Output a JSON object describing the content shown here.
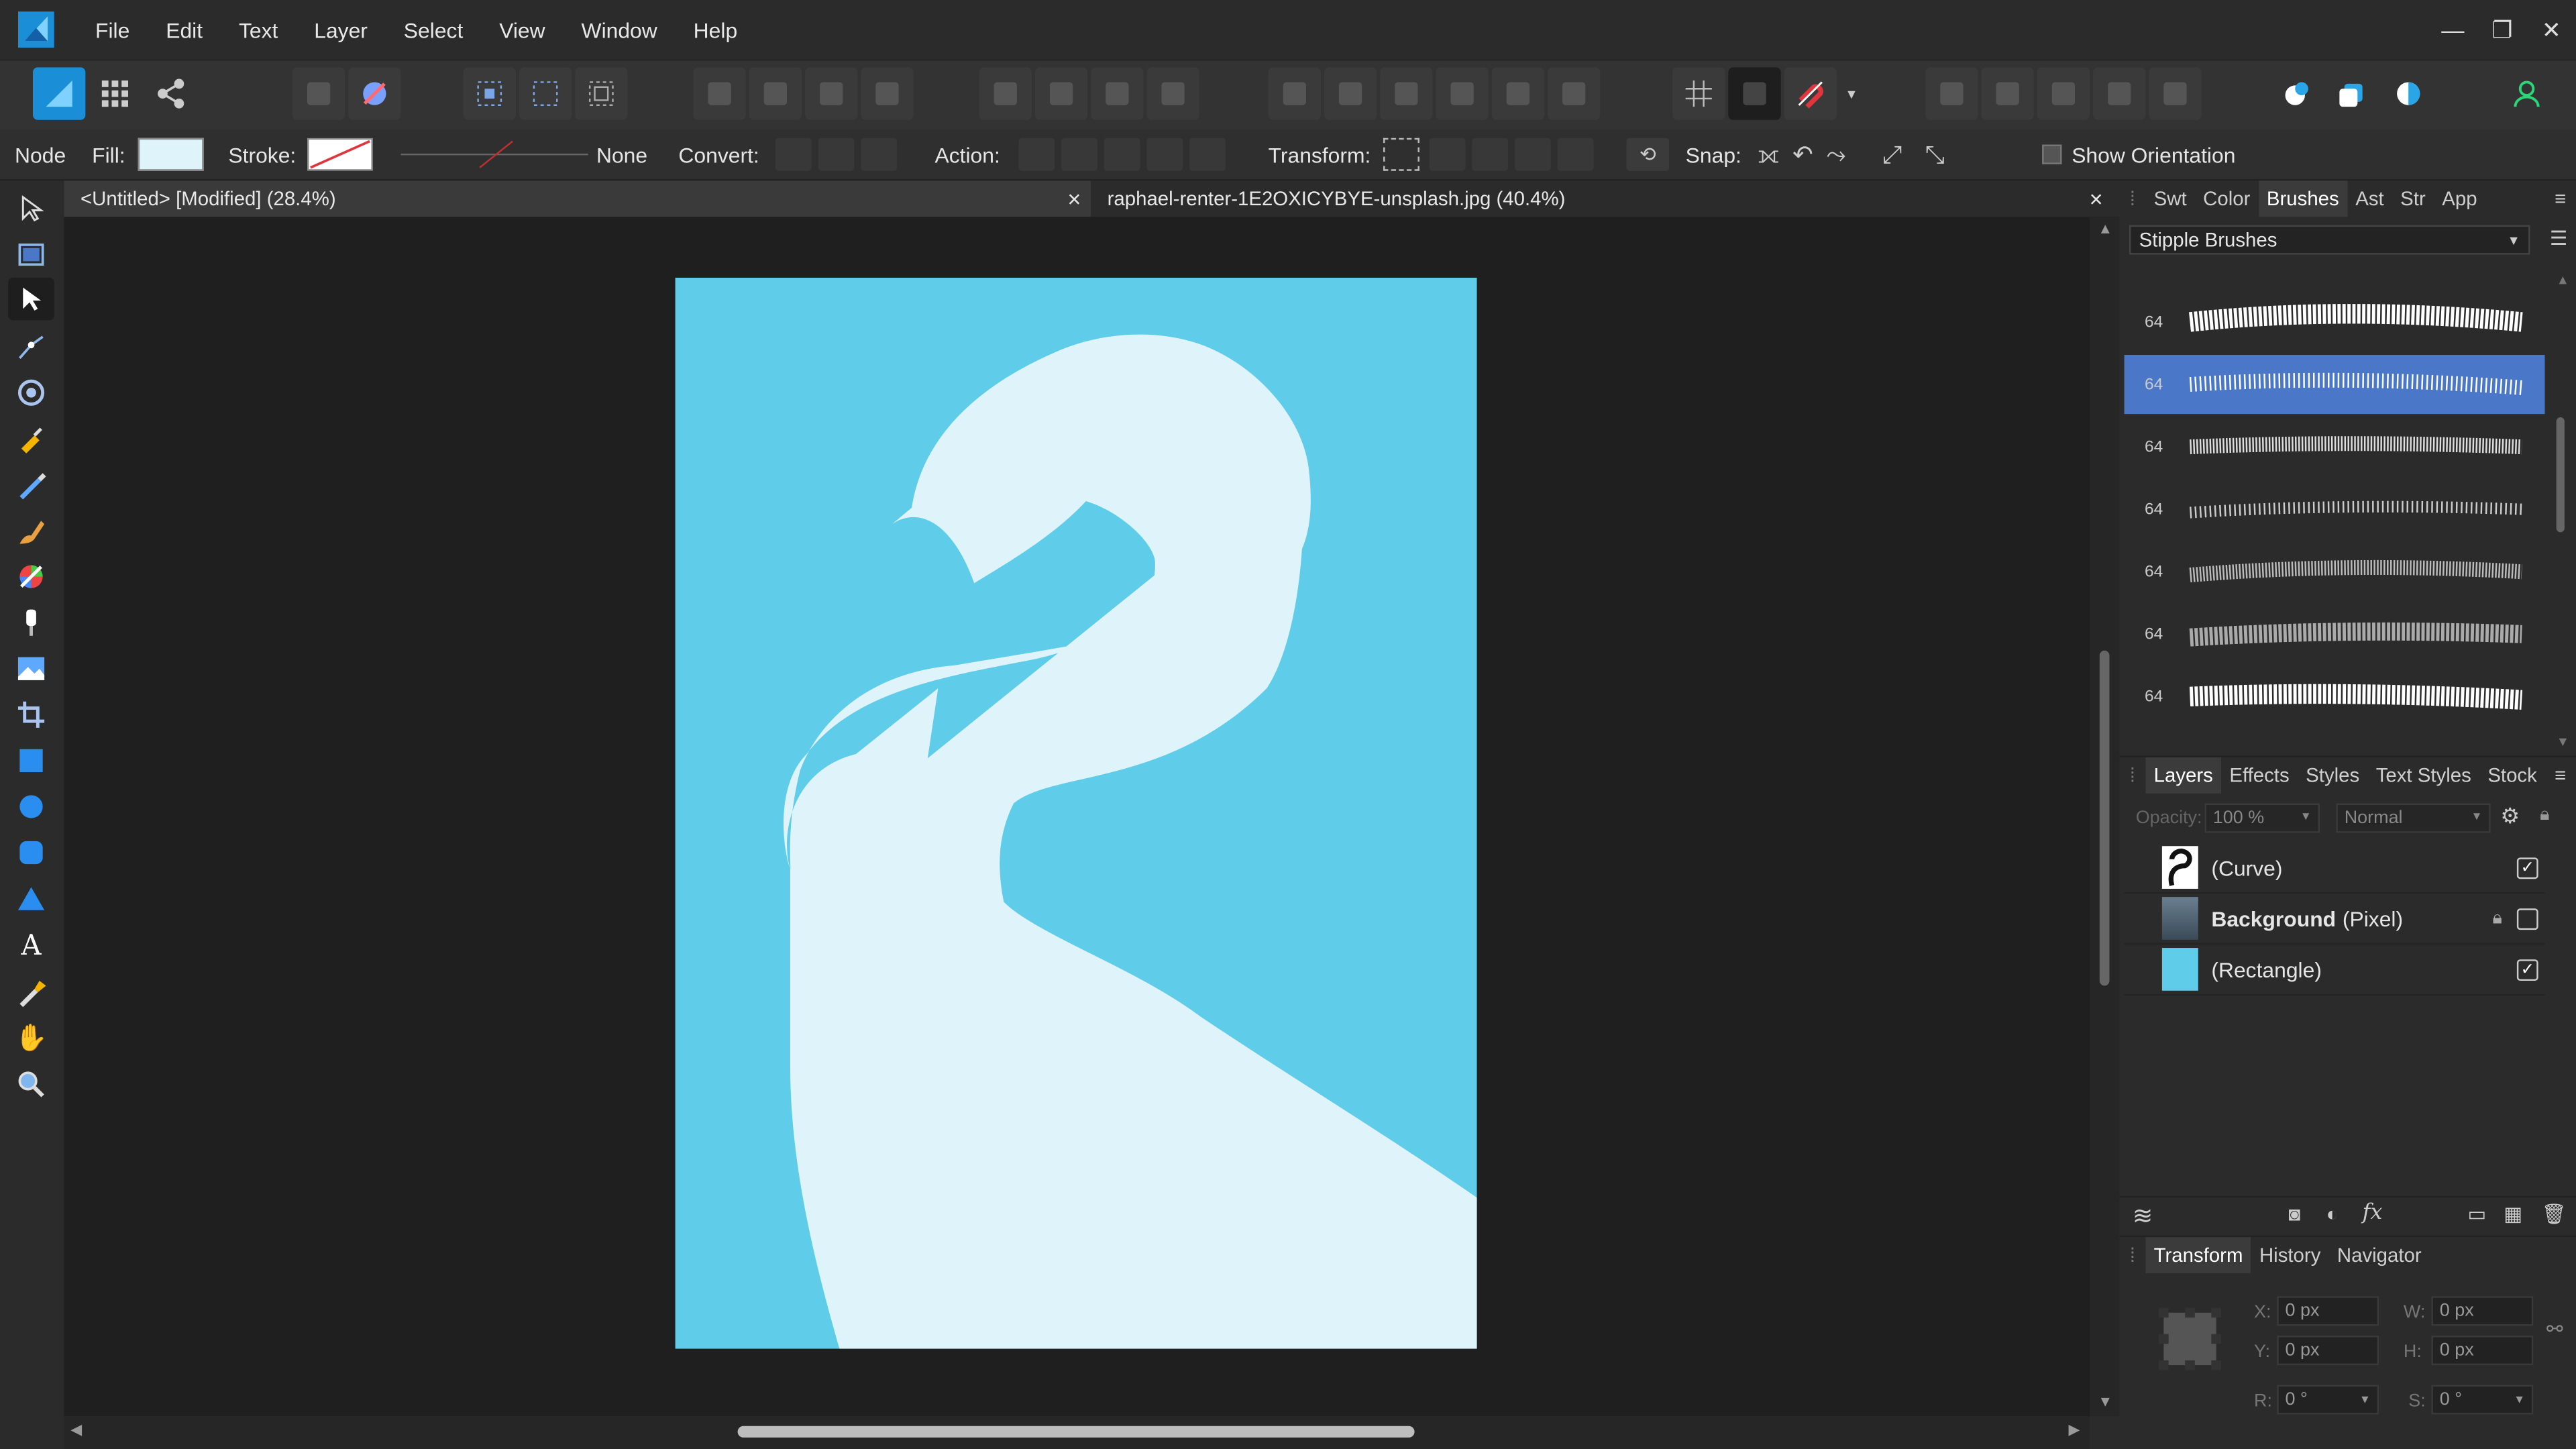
{
  "menu": [
    "File",
    "Edit",
    "Text",
    "Layer",
    "Select",
    "View",
    "Window",
    "Help"
  ],
  "context": {
    "mode_label": "Node",
    "fill_label": "Fill:",
    "stroke_label": "Stroke:",
    "stroke_width_value": "None",
    "convert_label": "Convert:",
    "action_label": "Action:",
    "transform_label": "Transform:",
    "snap_label": "Snap:",
    "show_orientation_label": "Show Orientation",
    "fill_color": "#dff3fb"
  },
  "documents": {
    "tab1": "<Untitled> [Modified] (28.4%)",
    "tab2": "raphael-renter-1E2OXICYBYE-unsplash.jpg (40.4%)",
    "close": "×"
  },
  "canvas": {
    "background_color": "#5fcde9",
    "shape_color": "#dff4fa"
  },
  "brushes_panel": {
    "tabs": [
      "Swt",
      "Color",
      "Brushes",
      "Ast",
      "Str",
      "App"
    ],
    "active_tab": "Brushes",
    "category": "Stipple Brushes",
    "brush_sizes": [
      "64",
      "64",
      "64",
      "64",
      "64",
      "64",
      "64"
    ],
    "selected_index": 1
  },
  "layers_panel": {
    "tabs": [
      "Layers",
      "Effects",
      "Styles",
      "Text Styles",
      "Stock"
    ],
    "opacity_label": "Opacity:",
    "opacity_value": "100 %",
    "blend_mode": "Normal",
    "layers": [
      {
        "name": "(Curve)",
        "bold_name": "",
        "checked": true
      },
      {
        "name": "(Pixel)",
        "bold_name": "Background",
        "checked": false,
        "locked": true
      },
      {
        "name": "(Rectangle)",
        "bold_name": "",
        "checked": true
      }
    ]
  },
  "transform_panel": {
    "tabs": [
      "Transform",
      "History",
      "Navigator"
    ],
    "x_label": "X:",
    "x_value": "0 px",
    "y_label": "Y:",
    "y_value": "0 px",
    "w_label": "W:",
    "w_value": "0 px",
    "h_label": "H:",
    "h_value": "0 px",
    "r_label": "R:",
    "r_value": "0 °",
    "s_label": "S:",
    "s_value": "0 °"
  },
  "icons": {
    "accent": "#2aa5e8",
    "snapping_color": "#e0353d",
    "persona_color": "#00b6e9"
  }
}
